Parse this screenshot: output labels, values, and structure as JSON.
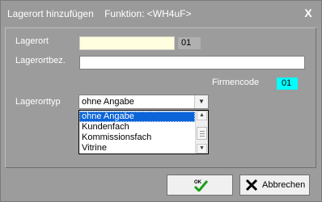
{
  "window": {
    "title": "Lagerort hinzufügen",
    "function_label": "Funktion: <WH4uF>",
    "close_glyph": "X"
  },
  "form": {
    "lagerort_label": "Lagerort",
    "lagerort_value": "",
    "lagerort_number": "01",
    "lagerortbez_label": "Lagerortbez.",
    "lagerortbez_value": "",
    "firmencode_label": "Firmencode",
    "firmencode_value": "01",
    "lagerorttyp_label": "Lagerorttyp",
    "lagerorttyp_selected": "ohne Angabe",
    "lagerorttyp_options": [
      "ohne Angabe",
      "Kundenfach",
      "Kommissionsfach",
      "Vitrine"
    ]
  },
  "buttons": {
    "ok_icon_text": "OK",
    "cancel_label": "Abbrechen"
  },
  "colors": {
    "lagerort_field_bg": "#ffffe0",
    "firmencode_bg": "#00ffff",
    "selected_option_bg": "#0a64d8"
  }
}
